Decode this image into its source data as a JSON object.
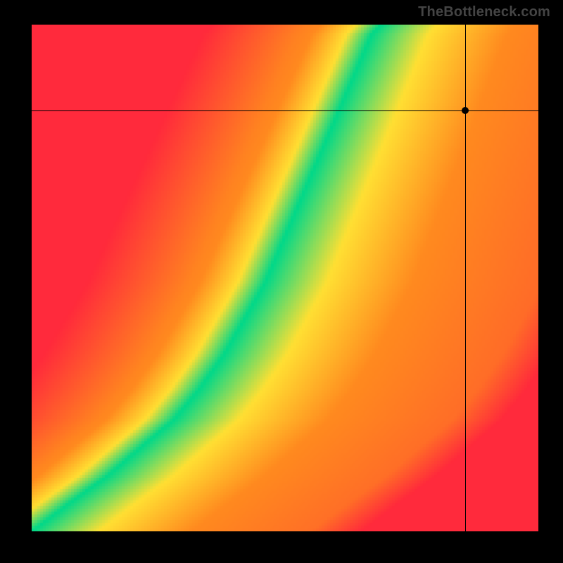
{
  "watermark": "TheBottleneck.com",
  "colors": {
    "red": "#ff2a3c",
    "orange": "#ff8a1f",
    "yellow": "#ffe033",
    "green": "#00d88a"
  },
  "chart_data": {
    "type": "heatmap",
    "title": "",
    "xlabel": "",
    "ylabel": "",
    "xlim": [
      0,
      1
    ],
    "ylim": [
      0,
      1
    ],
    "grid": false,
    "legend": false,
    "description": "Heatmap showing bottleneck fit. Green ridge indicates ideal pairing; color shifts through yellow and orange to red as mismatch grows. Crosshair marks a specific configuration point.",
    "ridge_points_xy": [
      [
        0.0,
        0.0
      ],
      [
        0.08,
        0.06
      ],
      [
        0.15,
        0.11
      ],
      [
        0.22,
        0.17
      ],
      [
        0.28,
        0.22
      ],
      [
        0.33,
        0.28
      ],
      [
        0.38,
        0.35
      ],
      [
        0.42,
        0.42
      ],
      [
        0.46,
        0.49
      ],
      [
        0.49,
        0.56
      ],
      [
        0.52,
        0.63
      ],
      [
        0.55,
        0.7
      ],
      [
        0.58,
        0.77
      ],
      [
        0.61,
        0.84
      ],
      [
        0.64,
        0.91
      ],
      [
        0.67,
        0.98
      ],
      [
        0.69,
        1.0
      ]
    ],
    "ridge_half_width_x": 0.05,
    "marker_xy": [
      0.855,
      0.83
    ]
  }
}
